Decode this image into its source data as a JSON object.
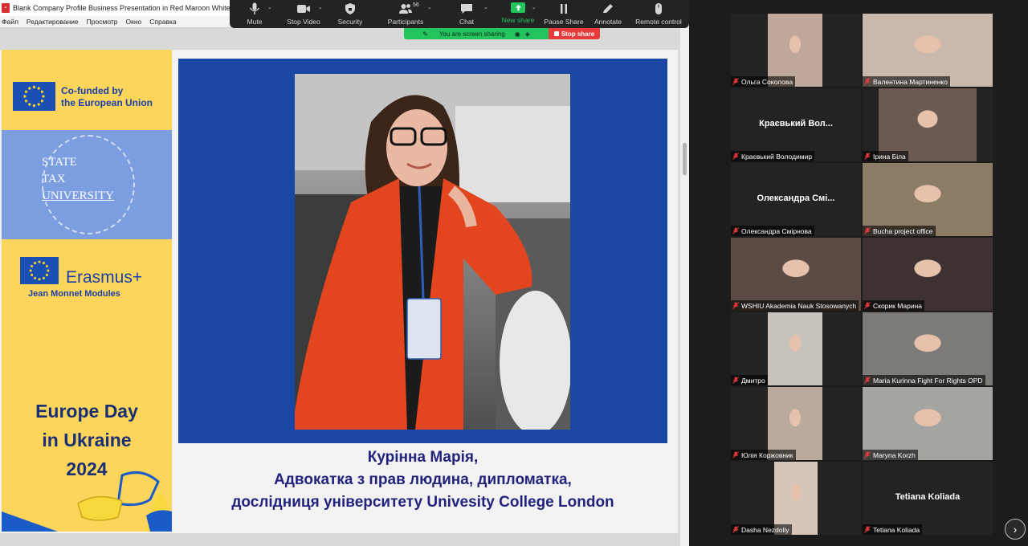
{
  "window": {
    "title": "Blank Company Profile Business Presentation in Red Maroon White Geometri",
    "menu": [
      "Файл",
      "Редактирование",
      "Просмотр",
      "Окно",
      "Справка"
    ]
  },
  "toolbar": {
    "mute": "Mute",
    "stop_video": "Stop Video",
    "security": "Security",
    "participants": "Participants",
    "participant_count": "56",
    "chat": "Chat",
    "new_share": "New share",
    "pause_share": "Pause Share",
    "annotate": "Annotate",
    "remote_control": "Remote control"
  },
  "share_banner": {
    "status": "You are screen sharing",
    "stop": "Stop share"
  },
  "slide": {
    "cofunded": [
      "Co-funded by",
      "the European Union"
    ],
    "university": [
      "STATE",
      "TAX",
      "UNIVERSITY"
    ],
    "erasmus": "Erasmus+",
    "jean_monnet": "Jean Monnet Modules",
    "europe_day": [
      "Europe Day",
      "in Ukraine",
      "2024"
    ],
    "caption": [
      "Курінна Марія,",
      "Адвокатка з прав людина, дипломатка,",
      "дослідниця університету Univesity College London"
    ],
    "colors": {
      "eu_blue": "#1a47a6",
      "yellow": "#fdd55a",
      "navy": "#22237d"
    }
  },
  "gallery": {
    "participants": [
      {
        "name": "Ольга Соколова",
        "type": "video"
      },
      {
        "name": "Валентина Мартиненко",
        "type": "video"
      },
      {
        "name": "Краєвький Володимир",
        "type": "name",
        "display": "Краєвький Вол..."
      },
      {
        "name": "Ірина Біла",
        "type": "video"
      },
      {
        "name": "Олександра Смірнова",
        "type": "name",
        "display": "Олександра Смі..."
      },
      {
        "name": "Bucha project office",
        "type": "video"
      },
      {
        "name": "WSHIU Akademia Nauk Stosowanych",
        "type": "video"
      },
      {
        "name": "Скорик Марина",
        "type": "video"
      },
      {
        "name": "Дмитро",
        "type": "video"
      },
      {
        "name": "Maria Kurinna Fight For Rights OPD",
        "type": "video",
        "active": true
      },
      {
        "name": "Юлія Коржовник",
        "type": "video"
      },
      {
        "name": "Maryna Korzh",
        "type": "video"
      },
      {
        "name": "Dasha Nezdoliy",
        "type": "video"
      },
      {
        "name": "Tetiana Koliada",
        "type": "name",
        "display": "Tetiana Koliada"
      }
    ],
    "next_icon": "chevron-right-icon"
  }
}
